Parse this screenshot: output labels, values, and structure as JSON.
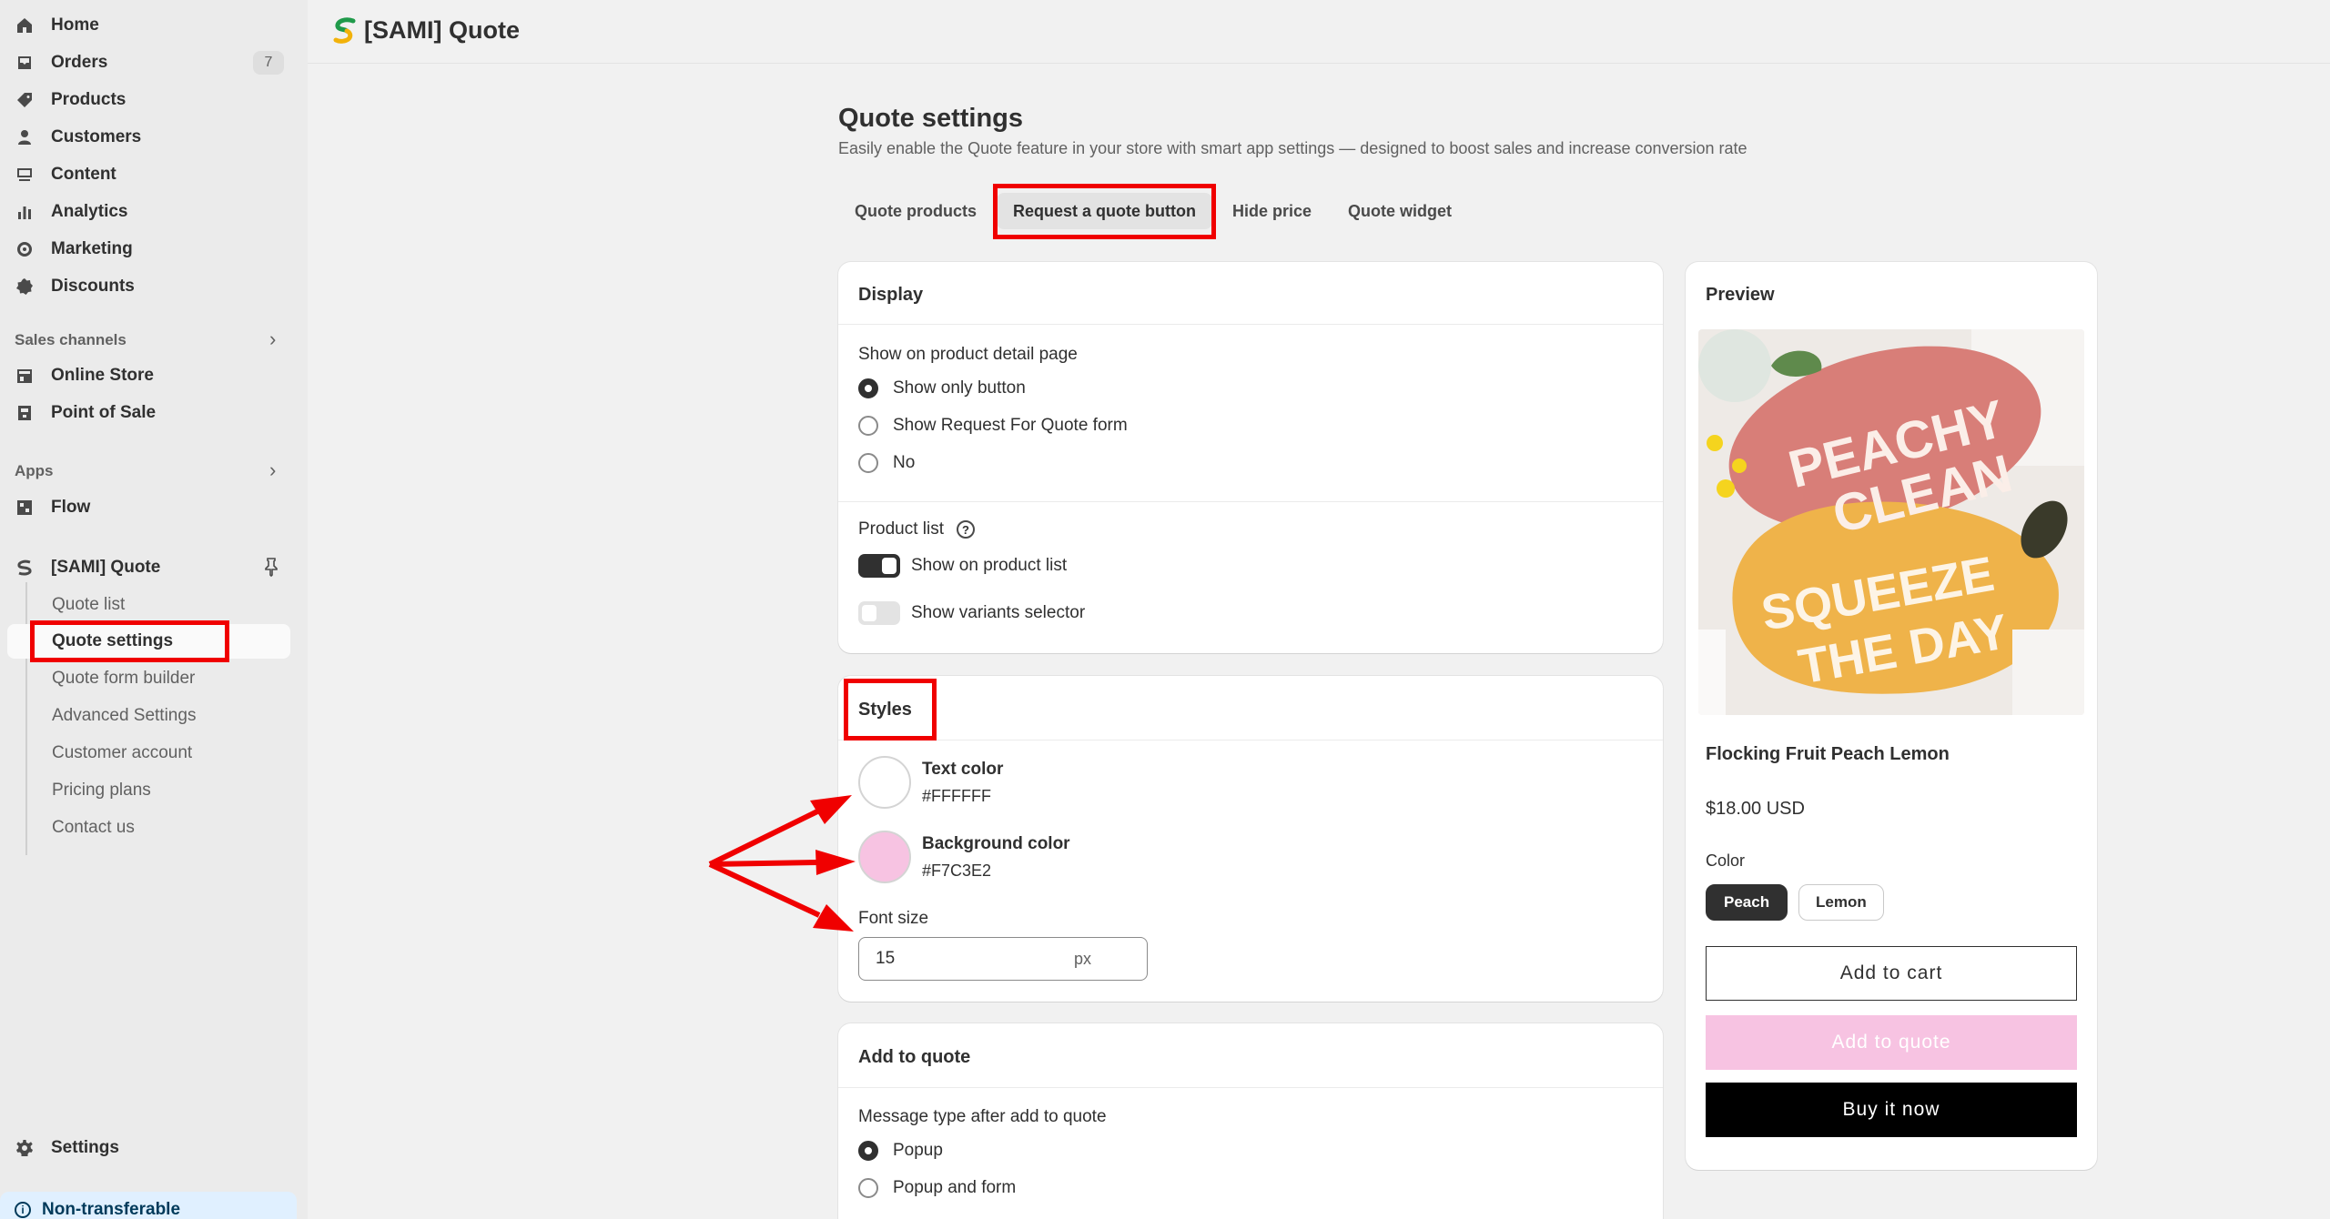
{
  "sidebar": {
    "items": [
      {
        "label": "Home",
        "icon": "home-icon"
      },
      {
        "label": "Orders",
        "icon": "orders-icon",
        "badge": "7"
      },
      {
        "label": "Products",
        "icon": "tag-icon"
      },
      {
        "label": "Customers",
        "icon": "person-icon"
      },
      {
        "label": "Content",
        "icon": "content-icon"
      },
      {
        "label": "Analytics",
        "icon": "bar-chart-icon"
      },
      {
        "label": "Marketing",
        "icon": "target-icon"
      },
      {
        "label": "Discounts",
        "icon": "discount-icon"
      }
    ],
    "sales_channels_label": "Sales channels",
    "sales_channels": [
      {
        "label": "Online Store",
        "icon": "store-icon"
      },
      {
        "label": "Point of Sale",
        "icon": "pos-icon"
      }
    ],
    "apps_label": "Apps",
    "apps": [
      {
        "label": "Flow",
        "icon": "flow-icon"
      }
    ],
    "app_name": "[SAMI] Quote",
    "app_subitems": [
      "Quote list",
      "Quote settings",
      "Quote form builder",
      "Advanced Settings",
      "Customer account",
      "Pricing plans",
      "Contact us"
    ],
    "active_subitem": "Quote settings",
    "settings_label": "Settings",
    "nontransferable_label": "Non-transferable"
  },
  "topbar": {
    "title": "[SAMI] Quote"
  },
  "page": {
    "title": "Quote settings",
    "subtitle": "Easily enable the Quote feature in your store with smart app settings — designed to boost sales and increase conversion rate",
    "tabs": [
      "Quote products",
      "Request a quote button",
      "Hide price",
      "Quote widget"
    ],
    "active_tab": "Request a quote button"
  },
  "display_card": {
    "title": "Display",
    "pdp_label": "Show on product detail page",
    "pdp_options": [
      "Show only button",
      "Show Request For Quote form",
      "No"
    ],
    "pdp_selected": "Show only button",
    "product_list_label": "Product list",
    "toggles": [
      {
        "label": "Show on product list",
        "on": true
      },
      {
        "label": "Show variants selector",
        "on": false
      }
    ]
  },
  "styles_card": {
    "title": "Styles",
    "text_color_label": "Text color",
    "text_color": "#FFFFFF",
    "bg_color_label": "Background color",
    "bg_color": "#F7C3E2",
    "font_size_label": "Font size",
    "font_size": "15",
    "font_size_unit": "px"
  },
  "add_to_quote_card": {
    "title": "Add to quote",
    "message_type_label": "Message type after add to quote",
    "options": [
      "Popup",
      "Popup and form"
    ],
    "selected": "Popup"
  },
  "preview": {
    "title": "Preview",
    "product_name": "Flocking Fruit Peach Lemon",
    "price": "$18.00 USD",
    "color_label": "Color",
    "colors": [
      "Peach",
      "Lemon"
    ],
    "selected_color": "Peach",
    "add_to_cart": "Add to cart",
    "add_to_quote": "Add to quote",
    "buy_now": "Buy it now",
    "rug_text_1": "PEACHY",
    "rug_text_2": "CLEAN",
    "rug_text_3": "SQUEEZE",
    "rug_text_4": "THE DAY"
  },
  "colors": {
    "highlight": "#F00000",
    "quote_button_bg": "#F7C3E2",
    "quote_button_text": "#FFFFFF"
  }
}
